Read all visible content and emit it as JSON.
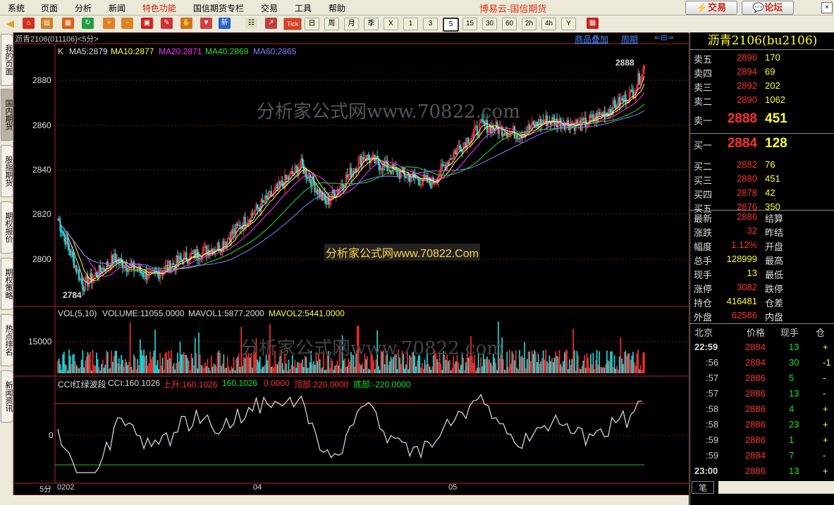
{
  "menubar": {
    "items": [
      "系统",
      "页面",
      "分析",
      "新闻",
      "特色功能",
      "国信期货专栏",
      "交易",
      "工具",
      "帮助"
    ],
    "app_title": "博易云-国信期货",
    "trade_button": "交易",
    "forum_button": "论坛"
  },
  "toolbar": {
    "tick_label": "Tick",
    "period_buttons": [
      "日",
      "周",
      "月",
      "季",
      "X",
      "1",
      "3",
      "5",
      "15",
      "30",
      "60",
      "2h",
      "4h",
      "Y"
    ],
    "active_period": "5"
  },
  "sidebar": {
    "tabs": [
      "我的页面",
      "国内期货",
      "股指期货",
      "期权报价",
      "期权策略",
      "热点排名",
      "新闻资讯"
    ]
  },
  "chart_header": {
    "instrument": "沥青2106(011106)<5分>",
    "overlay_link": "商品叠加",
    "cycle_link": "周期"
  },
  "main_indicators": {
    "k": "K",
    "ma5": "MA5:2879",
    "ma10": "MA10:2877",
    "ma20": "MA20:2871",
    "ma40": "MA40:2869",
    "ma60": "MA60:2865",
    "high_marker": "2888",
    "low_marker": "2784",
    "watermark1": "分析家公式网www.70822.com",
    "watermark2": "分析家公式网www.70822.Com"
  },
  "volume_indicators": {
    "title": "VOL(5,10)",
    "volume": "VOLUME:11055.0000",
    "mavol1": "MAVOL1:5877.2000",
    "mavol2": "MAVOL2:5441.0000",
    "watermark": "分析家公式网www.70822.com"
  },
  "cci_indicators": {
    "title": "CCI红绿波段",
    "cci": "CCI:160.1026",
    "up": "上升:160.1026",
    "val": "160.1026",
    "zero": "0.0000",
    "top": "顶部:220.0000",
    "bottom": "底部:-220.0000"
  },
  "axis": {
    "price_ticks": [
      "2880",
      "2860",
      "2840",
      "2820",
      "2800"
    ],
    "vol_tick": "15000",
    "cci_tick": "0",
    "period_label": "5分",
    "time_labels": [
      "0202",
      "04",
      "05"
    ]
  },
  "quote": {
    "title": "沥青2106(bu2106)",
    "asks": [
      {
        "label": "卖五",
        "price": "2896",
        "vol": "170"
      },
      {
        "label": "卖四",
        "price": "2894",
        "vol": "69"
      },
      {
        "label": "卖三",
        "price": "2892",
        "vol": "202"
      },
      {
        "label": "卖二",
        "price": "2890",
        "vol": "1062"
      },
      {
        "label": "卖一",
        "price": "2888",
        "vol": "451"
      }
    ],
    "bids": [
      {
        "label": "买一",
        "price": "2884",
        "vol": "128"
      },
      {
        "label": "买二",
        "price": "2882",
        "vol": "76"
      },
      {
        "label": "买三",
        "price": "2880",
        "vol": "451"
      },
      {
        "label": "买四",
        "price": "2878",
        "vol": "42"
      },
      {
        "label": "买五",
        "price": "2876",
        "vol": "350"
      }
    ],
    "stats": [
      {
        "label": "最新",
        "value": "2886",
        "label2": "结算"
      },
      {
        "label": "涨跌",
        "value": "32",
        "label2": "昨结"
      },
      {
        "label": "幅度",
        "value": "1.12%",
        "label2": "开盘"
      },
      {
        "label": "总手",
        "value": "128999",
        "label2": "最高"
      },
      {
        "label": "现手",
        "value": "13",
        "label2": "最低"
      },
      {
        "label": "涨停",
        "value": "3082",
        "label2": "跌停"
      },
      {
        "label": "持仓",
        "value": "416481",
        "label2": "仓差"
      },
      {
        "label": "外盘",
        "value": "62586",
        "label2": "内盘"
      }
    ],
    "ticks_header": {
      "c1": "北京",
      "c2": "价格",
      "c3": "现手",
      "c4": "仓"
    },
    "ticks": [
      {
        "time": "22:59",
        "price": "2884",
        "vol": "13",
        "chg": "+"
      },
      {
        "time": ":56",
        "price": "2884",
        "vol": "30",
        "chg": "-1"
      },
      {
        "time": ":57",
        "price": "2886",
        "vol": "5",
        "chg": "-"
      },
      {
        "time": ":57",
        "price": "2886",
        "vol": "13",
        "chg": "-"
      },
      {
        "time": ":58",
        "price": "2886",
        "vol": "4",
        "chg": "+"
      },
      {
        "time": ":58",
        "price": "2886",
        "vol": "23",
        "chg": "+"
      },
      {
        "time": ":59",
        "price": "2886",
        "vol": "1",
        "chg": "+"
      },
      {
        "time": ":59",
        "price": "2884",
        "vol": "7",
        "chg": "-"
      },
      {
        "time": "23:00",
        "price": "2886",
        "vol": "13",
        "chg": "+"
      }
    ],
    "bottom_tab": "笔"
  }
}
